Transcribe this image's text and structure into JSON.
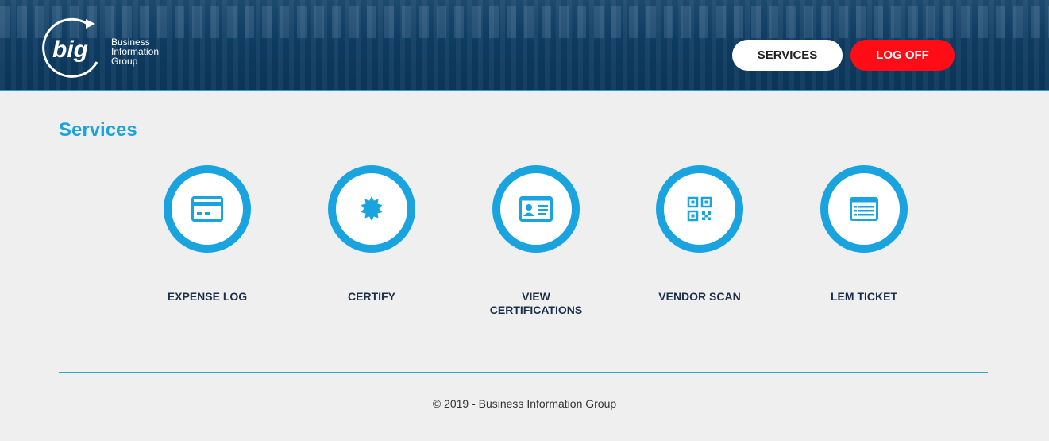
{
  "header": {
    "logo_mark": "big",
    "logo_lines": [
      "Business",
      "Information",
      "Group"
    ],
    "services_label": "SERVICES",
    "logoff_label": "LOG OFF"
  },
  "page": {
    "title": "Services"
  },
  "services": [
    {
      "label": "EXPENSE LOG",
      "icon": "credit-card-icon"
    },
    {
      "label": "CERTIFY",
      "icon": "certificate-badge-icon"
    },
    {
      "label": "VIEW\nCERTIFICATIONS",
      "icon": "id-card-icon"
    },
    {
      "label": "VENDOR SCAN",
      "icon": "qr-code-icon"
    },
    {
      "label": "LEM TICKET",
      "icon": "list-document-icon"
    }
  ],
  "footer": {
    "copyright": "© 2019 - Business Information Group"
  },
  "colors": {
    "accent": "#19a4e0",
    "logoff": "#ff0d16",
    "header": "#0e3b62"
  }
}
